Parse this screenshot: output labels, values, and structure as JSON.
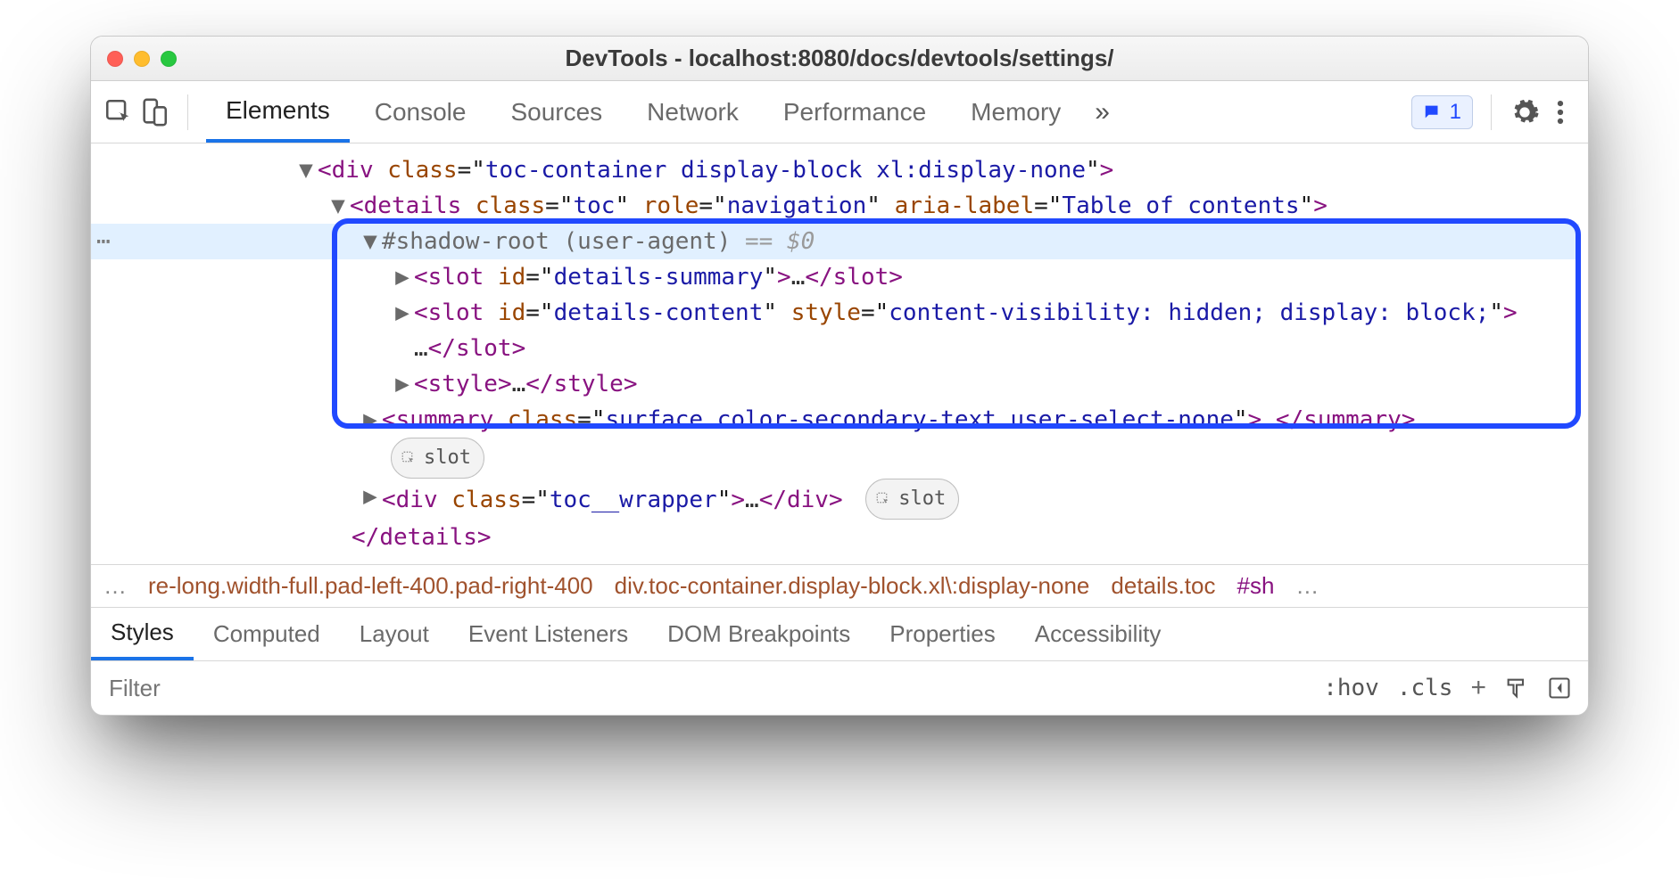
{
  "window": {
    "title": "DevTools - localhost:8080/docs/devtools/settings/"
  },
  "toolbar": {
    "tabs": [
      "Elements",
      "Console",
      "Sources",
      "Network",
      "Performance",
      "Memory"
    ],
    "active_tab_index": 0,
    "overflow_glyph": "»",
    "issues_count": "1"
  },
  "dom_tree": {
    "gutter_dots": "⋯",
    "line1": {
      "arrow": "▼",
      "tag": "div",
      "attr_name": "class",
      "attr_value": "toc-container display-block xl:display-none"
    },
    "line2": {
      "arrow": "▼",
      "tag": "details",
      "attr_class": "toc",
      "attr_role": "navigation",
      "attr_aria": "Table of contents"
    },
    "line3": {
      "arrow": "▼",
      "label": "#shadow-root (user-agent)",
      "suffix_eq": "==",
      "suffix_var": "$0"
    },
    "line4": {
      "arrow": "▶",
      "tag": "slot",
      "attr_name": "id",
      "attr_value": "details-summary",
      "ellipsis": "…"
    },
    "line5": {
      "arrow": "▶",
      "tag": "slot",
      "attr_id": "details-content",
      "attr_style": "content-visibility: hidden; display: block;",
      "ellipsis": "…"
    },
    "line6": {
      "arrow": "▶",
      "tag": "style",
      "ellipsis": "…"
    },
    "line7": {
      "arrow": "▶",
      "tag": "summary",
      "attr_name": "class",
      "attr_value": "surface color-secondary-text user-select-none",
      "ellipsis": "…"
    },
    "pill1": "slot",
    "line8": {
      "arrow": "▶",
      "tag": "div",
      "attr_name": "class",
      "attr_value": "toc__wrapper",
      "ellipsis": "…"
    },
    "pill2": "slot",
    "line9": {
      "close": "details"
    }
  },
  "breadcrumbs": {
    "left_dots": "…",
    "items": [
      "re-long.width-full.pad-left-400.pad-right-400",
      "div.toc-container.display-block.xl\\:display-none",
      "details.toc",
      "#sh"
    ],
    "right_dots": "…"
  },
  "styles_tabs": [
    "Styles",
    "Computed",
    "Layout",
    "Event Listeners",
    "DOM Breakpoints",
    "Properties",
    "Accessibility"
  ],
  "styles_active_index": 0,
  "filter": {
    "placeholder": "Filter",
    "hov": ":hov",
    "cls": ".cls",
    "plus": "+"
  }
}
